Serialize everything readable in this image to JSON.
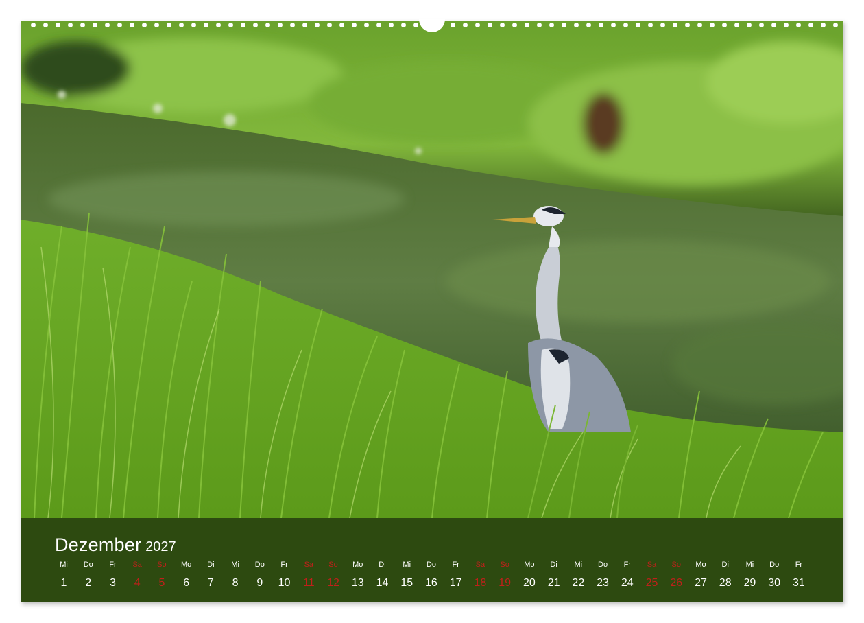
{
  "calendar": {
    "month": "Dezember",
    "year": "2027",
    "colors": {
      "bar": "#2d4a10",
      "text": "#ffffff",
      "weekend": "#c0201a"
    },
    "days": [
      {
        "name": "Mi",
        "num": "1",
        "weekend": false
      },
      {
        "name": "Do",
        "num": "2",
        "weekend": false
      },
      {
        "name": "Fr",
        "num": "3",
        "weekend": false
      },
      {
        "name": "Sa",
        "num": "4",
        "weekend": true
      },
      {
        "name": "So",
        "num": "5",
        "weekend": true
      },
      {
        "name": "Mo",
        "num": "6",
        "weekend": false
      },
      {
        "name": "Di",
        "num": "7",
        "weekend": false
      },
      {
        "name": "Mi",
        "num": "8",
        "weekend": false
      },
      {
        "name": "Do",
        "num": "9",
        "weekend": false
      },
      {
        "name": "Fr",
        "num": "10",
        "weekend": false
      },
      {
        "name": "Sa",
        "num": "11",
        "weekend": true
      },
      {
        "name": "So",
        "num": "12",
        "weekend": true
      },
      {
        "name": "Mo",
        "num": "13",
        "weekend": false
      },
      {
        "name": "Di",
        "num": "14",
        "weekend": false
      },
      {
        "name": "Mi",
        "num": "15",
        "weekend": false
      },
      {
        "name": "Do",
        "num": "16",
        "weekend": false
      },
      {
        "name": "Fr",
        "num": "17",
        "weekend": false
      },
      {
        "name": "Sa",
        "num": "18",
        "weekend": true
      },
      {
        "name": "So",
        "num": "19",
        "weekend": true
      },
      {
        "name": "Mo",
        "num": "20",
        "weekend": false
      },
      {
        "name": "Di",
        "num": "21",
        "weekend": false
      },
      {
        "name": "Mi",
        "num": "22",
        "weekend": false
      },
      {
        "name": "Do",
        "num": "23",
        "weekend": false
      },
      {
        "name": "Fr",
        "num": "24",
        "weekend": false
      },
      {
        "name": "Sa",
        "num": "25",
        "weekend": true
      },
      {
        "name": "So",
        "num": "26",
        "weekend": true
      },
      {
        "name": "Mo",
        "num": "27",
        "weekend": false
      },
      {
        "name": "Di",
        "num": "28",
        "weekend": false
      },
      {
        "name": "Mi",
        "num": "29",
        "weekend": false
      },
      {
        "name": "Do",
        "num": "30",
        "weekend": false
      },
      {
        "name": "Fr",
        "num": "31",
        "weekend": false
      }
    ]
  },
  "photo": {
    "subject": "heron-photo",
    "colors": {
      "grass": "#5e9a1e",
      "water": "#3f5a2a",
      "bank": "#7fb53a",
      "heron": "#8c97a8"
    }
  }
}
